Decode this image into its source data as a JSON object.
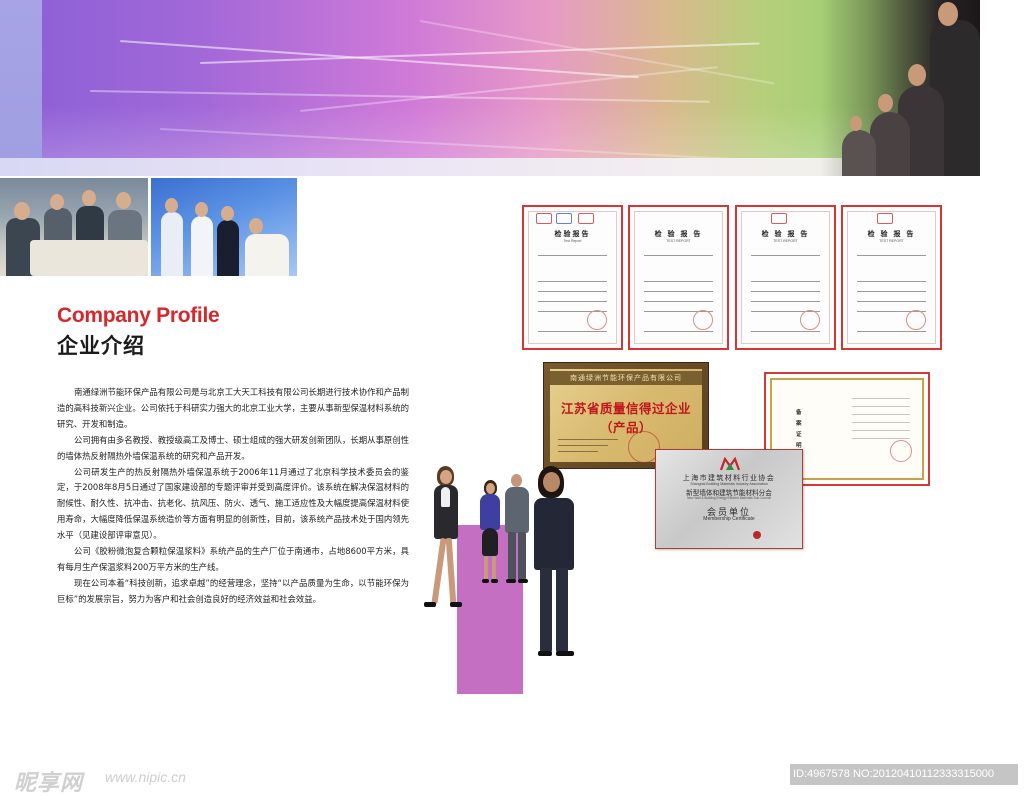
{
  "header": {
    "banner_name": "colorful-banner",
    "accent_colors": [
      "#8a5fd6",
      "#d07ad8",
      "#9ccf73"
    ]
  },
  "title": {
    "english": "Company Profile",
    "chinese": "企业介绍",
    "english_color": "#d6282b"
  },
  "body": {
    "paragraphs": [
      "南通绿洲节能环保产品有限公司是与北京工大天工科技有限公司长期进行技术协作和产品制造的高科技新兴企业。公司依托于科研实力强大的北京工业大学，主要从事新型保温材料系统的研究、开发和制造。",
      "公司拥有由多名教授、教授级高工及博士、硕士组成的强大研发创新团队，长期从事原创性的墙体热反射隔热外墙保温系统的研究和产品开发。",
      "公司研发生产的热反射隔热外墙保温系统于2006年11月通过了北京科学技术委员会的鉴定，于2008年8月5日通过了国家建设部的专题评审并受到高度评价。该系统在解决保温材料的耐候性、耐久性、抗冲击、抗老化、抗风压、防火、透气、施工适应性及大幅度提高保温材料使用寿命，大幅度降低保温系统造价等方面有明显的创新性，目前，该系统产品技术处于国内领先水平（见建设部评审意见）。",
      "公司《胶粉微泡复合颗粒保温浆料》系统产品的生产厂位于南通市，占地8600平方米，具有每月生产保温浆料200万平方米的生产线。",
      "现在公司本着“科技创新，追求卓越”的经营理念，坚持“以产品质量为生命，以节能环保为巨标”的发展宗旨，努力为客户和社会创造良好的经济效益和社会效益。"
    ]
  },
  "reports": [
    {
      "title": "检验报告",
      "subtitle": "Test Report"
    },
    {
      "title": "检 验 报 告",
      "subtitle": "TEST REPORT"
    },
    {
      "title": "检 验 报 告",
      "subtitle": "TEST REPORT"
    },
    {
      "title": "检 验 报 告",
      "subtitle": "TEST REPORT"
    }
  ],
  "plaque": {
    "company": "南通绿洲节能环保产品有限公司",
    "honor": "江苏省质量信得过企业（产品）"
  },
  "record_certificate": {
    "lines": [
      "备",
      "案",
      "证",
      "明"
    ]
  },
  "membership": {
    "association_cn": "上海市建筑材料行业协会",
    "association_en": "Shanghai Building Materials Industry Association",
    "branch_cn": "新型墙体和建筑节能材料分会",
    "branch_en": "New Wall & Building Energy Efficient Materials Sub-Council",
    "unit_cn": "会员单位",
    "unit_en": "Membership Certificate"
  },
  "watermark": {
    "logo": "昵享网",
    "url": "www.nipic.cn",
    "id_text": "ID:4967578 NO:20120410112333315000"
  }
}
